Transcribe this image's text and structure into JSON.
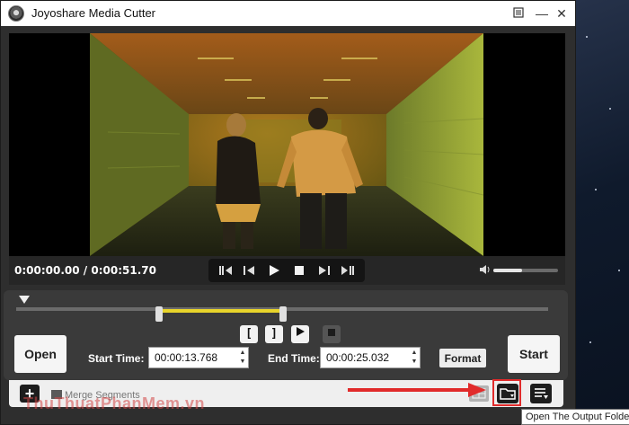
{
  "window": {
    "title": "Joyoshare Media Cutter",
    "menu_icon": "menu-icon",
    "minimize_label": "—",
    "close_label": "✕"
  },
  "player": {
    "time_display": "0:00:00.00 / 0:00:51.70",
    "controls": [
      "previous-segment-icon",
      "step-back-icon",
      "play-icon",
      "stop-icon",
      "step-forward-icon",
      "next-segment-icon"
    ],
    "volume": 0.45
  },
  "timeline": {
    "playhead": 0.0,
    "segment_start": 0.266,
    "segment_end": 0.485
  },
  "edit": {
    "open_label": "Open",
    "start_time_label": "Start Time:",
    "start_time_value": "00:00:13.768",
    "end_time_label": "End Time:",
    "end_time_value": "00:00:25.032",
    "format_label": "Format",
    "start_label": "Start",
    "mark_in": "[",
    "mark_out": "]"
  },
  "bottom": {
    "add_label": "+",
    "merge_label": "Merge Segments",
    "tooltip": "Open The Output Folder"
  },
  "watermark": "ThuThuatPhanMem.vn",
  "colors": {
    "accent": "#e8d42a",
    "highlight": "#e12b2b",
    "panel": "#3a3a3a"
  }
}
